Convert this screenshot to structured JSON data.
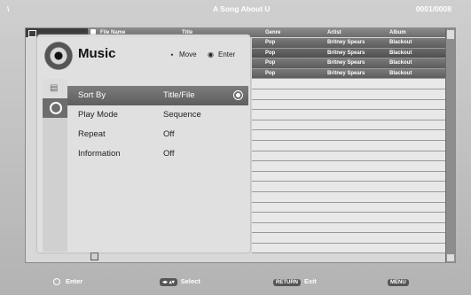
{
  "top_bar": {
    "path": "\\",
    "title": "A Song About U",
    "count": "0001/0008"
  },
  "list": {
    "headers": {
      "file_name": "File Name",
      "title": "Title",
      "genre": "Genre",
      "artist": "Artist",
      "album": "Album"
    },
    "rows": [
      {
        "genre": "Pop",
        "artist": "Britney Spears",
        "album": "Blackout"
      },
      {
        "genre": "Pop",
        "artist": "Britney Spears",
        "album": "Blackout"
      },
      {
        "genre": "Pop",
        "artist": "Britney Spears",
        "album": "Blackout"
      },
      {
        "genre": "Pop",
        "artist": "Britney Spears",
        "album": "Blackout"
      }
    ]
  },
  "menu": {
    "title": "Music",
    "move_label": "Move",
    "enter_label": "Enter",
    "options": [
      {
        "label": "Sort By",
        "value": "Title/File",
        "selected": true
      },
      {
        "label": "Play Mode",
        "value": "Sequence"
      },
      {
        "label": "Repeat",
        "value": "Off"
      },
      {
        "label": "Information",
        "value": "Off"
      }
    ]
  },
  "footer": {
    "enter": "Enter",
    "select": "Select",
    "return_key": "RETURN",
    "exit": "Exit",
    "menu_key": "MENU"
  }
}
